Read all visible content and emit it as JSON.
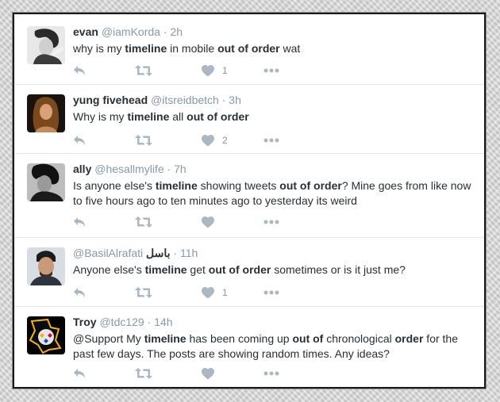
{
  "colors": {
    "icon": "#aab8c2",
    "name": "#292f33",
    "meta": "#8899a6",
    "divider": "#e1e8ed"
  },
  "icons": {
    "reply": "reply-icon",
    "retweet": "retweet-icon",
    "like": "heart-icon",
    "more": "more-icon"
  },
  "tweets": [
    {
      "name": "evan",
      "handle": "@iamKorda",
      "time": "2h",
      "text": [
        {
          "t": "why is my "
        },
        {
          "t": "timeline",
          "b": true
        },
        {
          "t": " in mobile "
        },
        {
          "t": "out of order",
          "b": true
        },
        {
          "t": " wat"
        }
      ],
      "likes": "1"
    },
    {
      "name": "yung fivehead",
      "handle": "@itsreidbetch",
      "time": "3h",
      "text": [
        {
          "t": "Why is my "
        },
        {
          "t": "timeline",
          "b": true
        },
        {
          "t": " all "
        },
        {
          "t": "out of order",
          "b": true
        }
      ],
      "likes": "2"
    },
    {
      "name": "ally",
      "handle": "@hesallmylife",
      "time": "7h",
      "text": [
        {
          "t": "Is anyone else's "
        },
        {
          "t": "timeline",
          "b": true
        },
        {
          "t": " showing tweets "
        },
        {
          "t": "out of order",
          "b": true
        },
        {
          "t": "? Mine goes from like now to five hours ago to ten minutes ago to yesterday its weird"
        }
      ],
      "likes": ""
    },
    {
      "name": "باسل",
      "handle": "@BasilAlrafati",
      "time": "11h",
      "text": [
        {
          "t": "Anyone else's "
        },
        {
          "t": "timeline",
          "b": true
        },
        {
          "t": " get "
        },
        {
          "t": "out of order",
          "b": true
        },
        {
          "t": " sometimes or is it just me?"
        }
      ],
      "likes": "1"
    },
    {
      "name": "Troy",
      "handle": "@tdc129",
      "time": "14h",
      "text": [
        {
          "t": "@Support My "
        },
        {
          "t": "timeline",
          "b": true
        },
        {
          "t": " has been coming up "
        },
        {
          "t": "out of",
          "b": true
        },
        {
          "t": " chronological "
        },
        {
          "t": "order",
          "b": true
        },
        {
          "t": " for the past few days. The posts are showing random times.  Any ideas?"
        }
      ],
      "likes": ""
    }
  ]
}
